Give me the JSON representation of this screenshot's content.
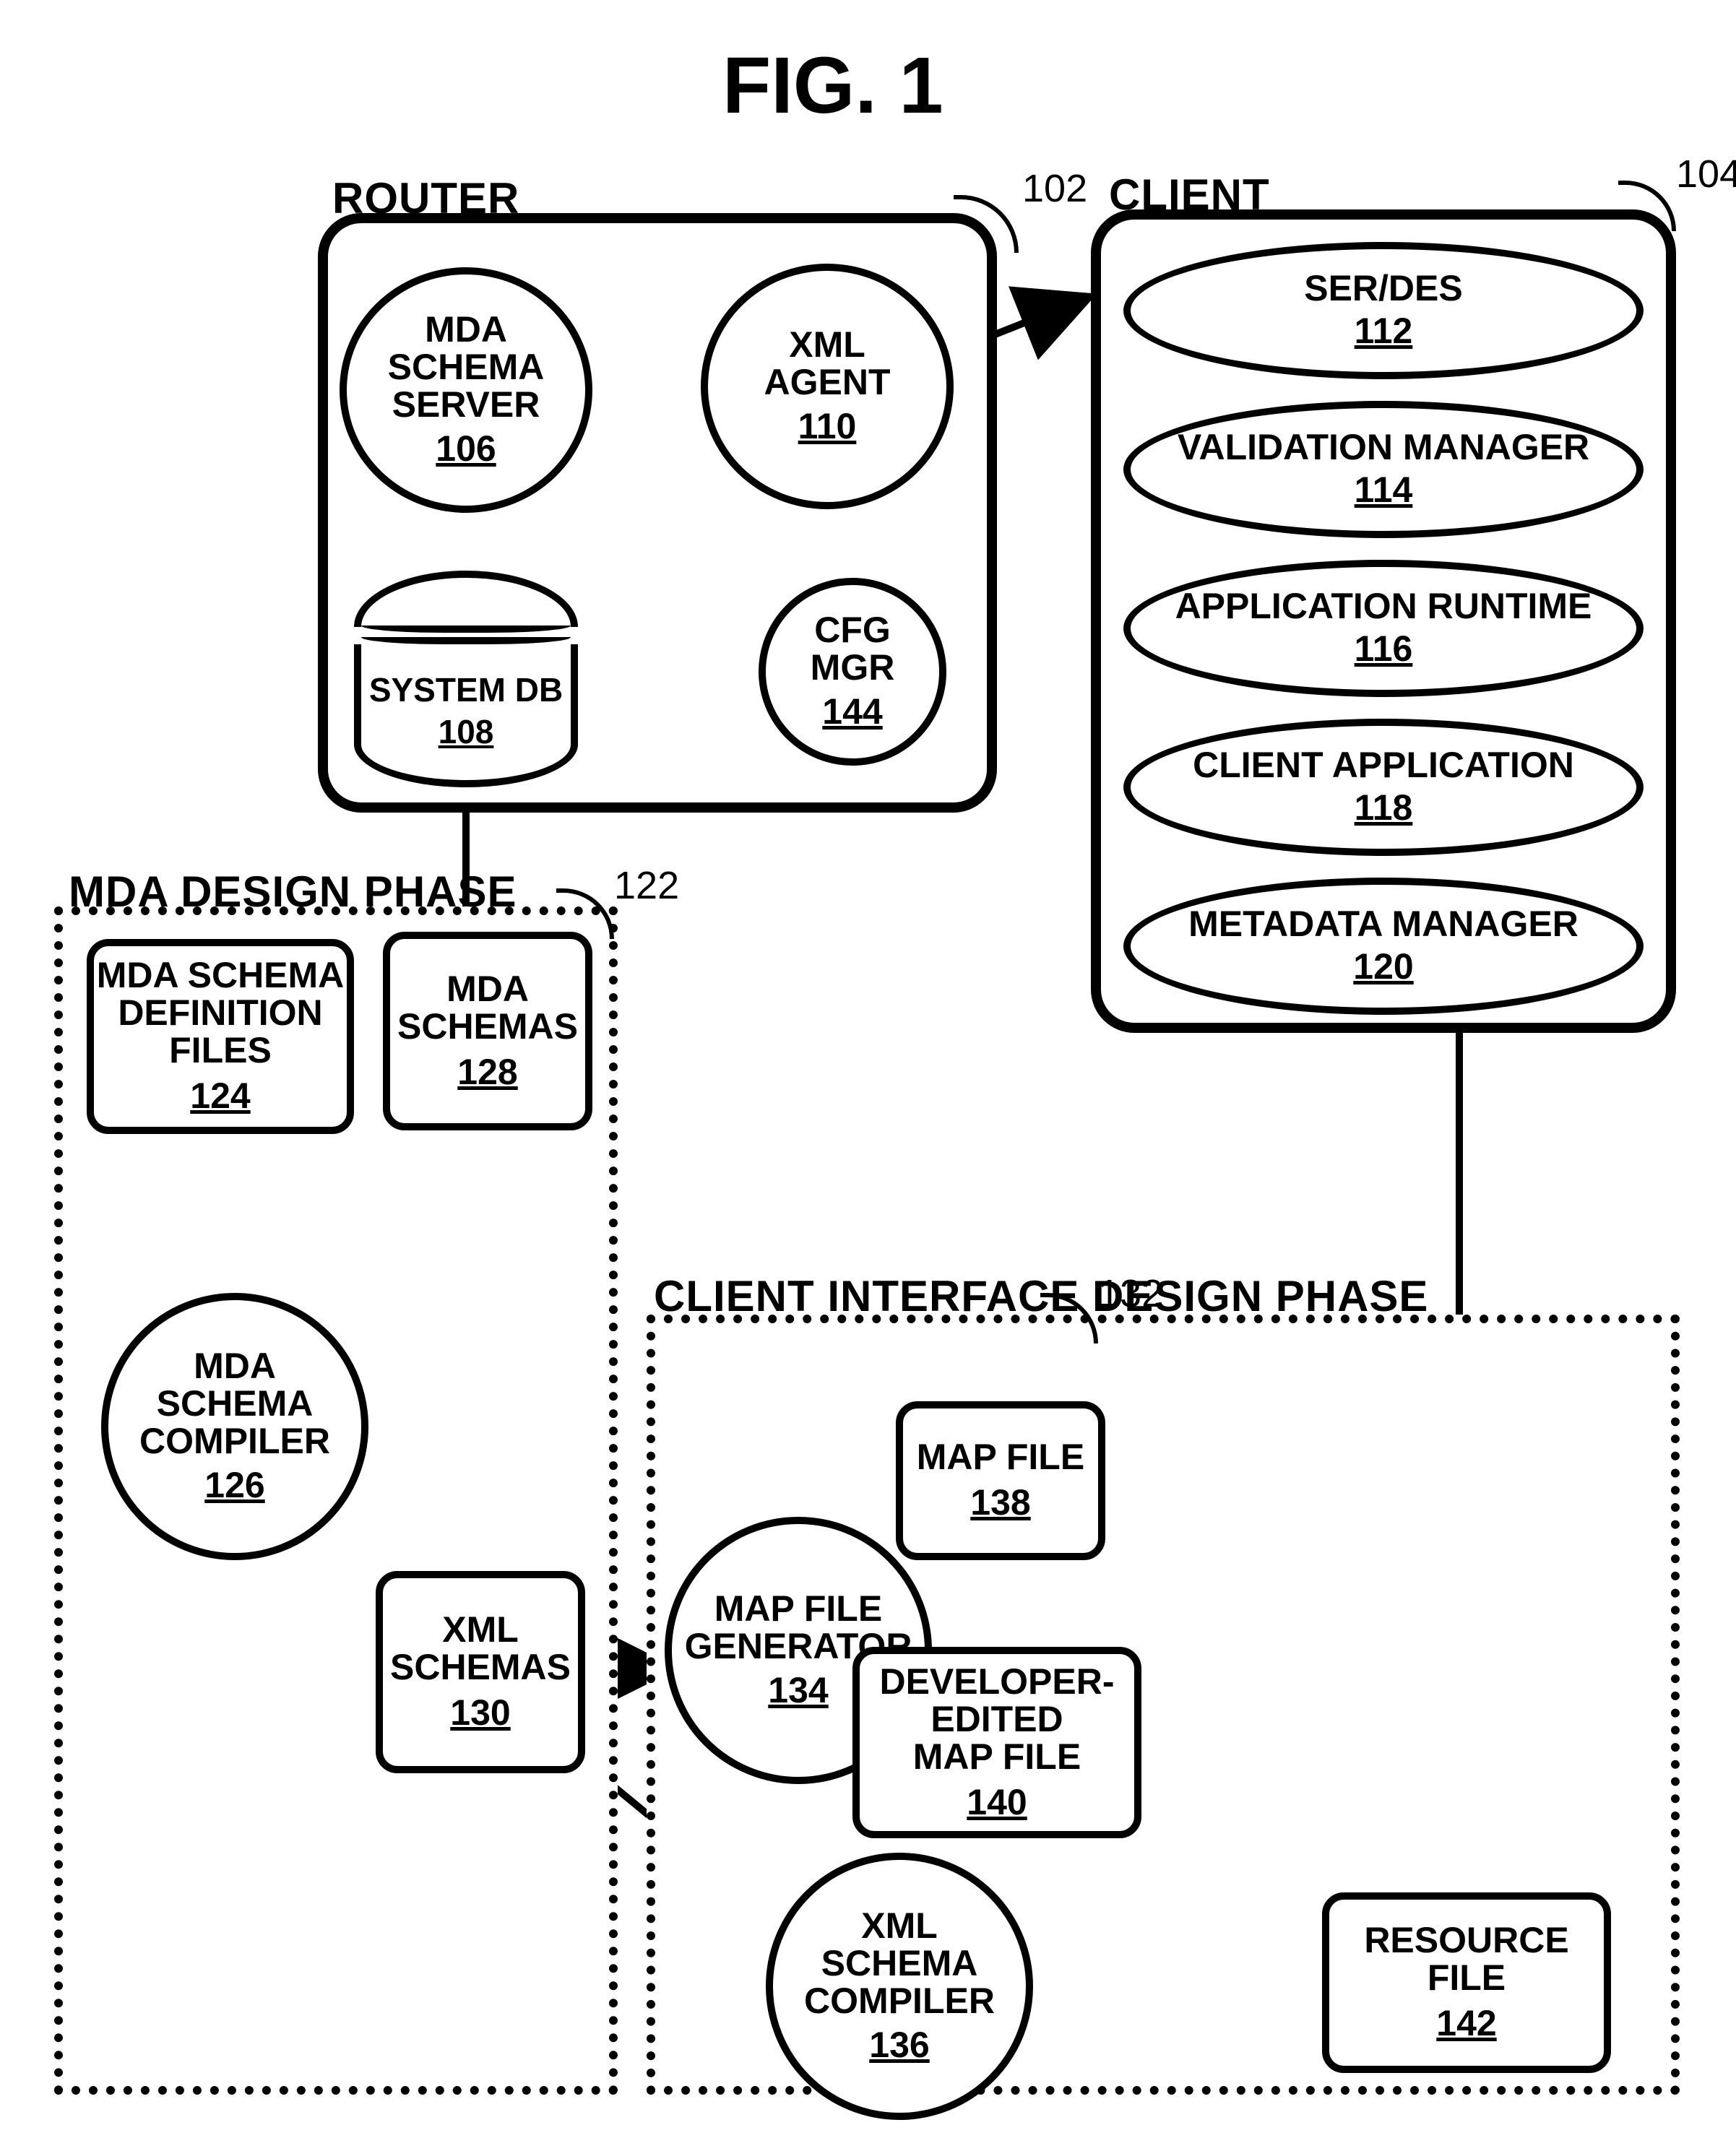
{
  "figure_title": "FIG. 1",
  "router": {
    "label": "ROUTER",
    "ref": "102",
    "mda_schema_server": {
      "name": "MDA\nSCHEMA\nSERVER",
      "num": "106"
    },
    "xml_agent": {
      "name": "XML\nAGENT",
      "num": "110"
    },
    "system_db": {
      "name": "SYSTEM DB",
      "num": "108"
    },
    "cfg_mgr": {
      "name": "CFG\nMGR",
      "num": "144"
    }
  },
  "client": {
    "label": "CLIENT",
    "ref": "104",
    "items": [
      {
        "name": "SER/DES",
        "num": "112"
      },
      {
        "name": "VALIDATION MANAGER",
        "num": "114"
      },
      {
        "name": "APPLICATION RUNTIME",
        "num": "116"
      },
      {
        "name": "CLIENT APPLICATION",
        "num": "118"
      },
      {
        "name": "METADATA MANAGER",
        "num": "120"
      }
    ]
  },
  "mda_phase": {
    "label": "MDA  DESIGN PHASE",
    "ref": "122",
    "def_files": {
      "name": "MDA SCHEMA\nDEFINITION\nFILES",
      "num": "124"
    },
    "compiler": {
      "name": "MDA\nSCHEMA\nCOMPILER",
      "num": "126"
    },
    "mda_schemas": {
      "name": "MDA\nSCHEMAS",
      "num": "128"
    },
    "xml_schemas": {
      "name": "XML\nSCHEMAS",
      "num": "130"
    }
  },
  "client_phase": {
    "label": "CLIENT INTERFACE DESIGN PHASE",
    "ref": "132",
    "map_gen": {
      "name": "MAP FILE\nGENERATOR",
      "num": "134"
    },
    "map_file": {
      "name": "MAP FILE",
      "num": "138"
    },
    "dev_map_file": {
      "name": "DEVELOPER-\nEDITED\nMAP FILE",
      "num": "140"
    },
    "xml_compiler": {
      "name": "XML\nSCHEMA\nCOMPILER",
      "num": "136"
    },
    "resource_file": {
      "name": "RESOURCE\nFILE",
      "num": "142"
    }
  }
}
